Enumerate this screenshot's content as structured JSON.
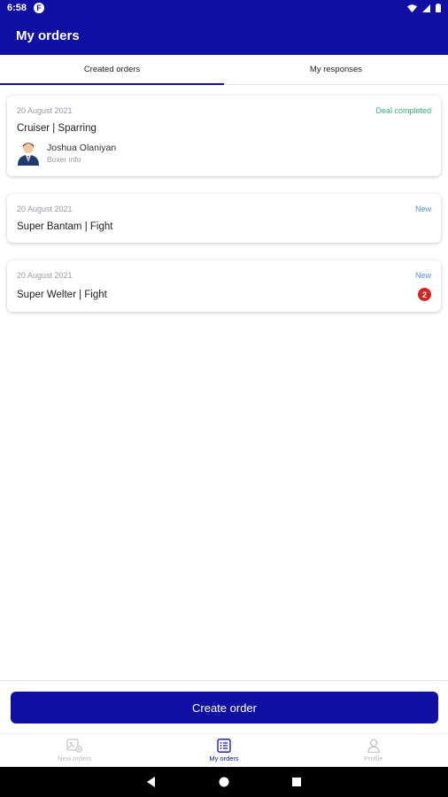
{
  "status_bar": {
    "time": "6:58",
    "app_icon_letter": "F"
  },
  "app_bar": {
    "title": "My orders"
  },
  "tabs": [
    {
      "label": "Created orders",
      "active": true
    },
    {
      "label": "My responses",
      "active": false
    }
  ],
  "orders": [
    {
      "date": "20 August 2021",
      "status": "Deal completed",
      "title": "Cruiser | Sparring",
      "boxer": {
        "name": "Joshua Olaniyan",
        "subtitle": "Boxer info"
      }
    },
    {
      "date": "20 August 2021",
      "status": "New",
      "title": "Super Bantam | Fight"
    },
    {
      "date": "20 August 2021",
      "status": "New",
      "title": "Super Welter | Fight",
      "badge": "2"
    }
  ],
  "create_button": {
    "label": "Create order"
  },
  "bottom_nav": [
    {
      "label": "New orders",
      "icon": "new-orders-icon",
      "active": false
    },
    {
      "label": "My orders",
      "icon": "list-icon",
      "active": true
    },
    {
      "label": "Profile",
      "icon": "profile-icon",
      "active": false
    }
  ],
  "colors": {
    "primary": "#0f0fa3",
    "completed": "#35b37e",
    "new": "#5b8fd6",
    "badge": "#d32424"
  }
}
